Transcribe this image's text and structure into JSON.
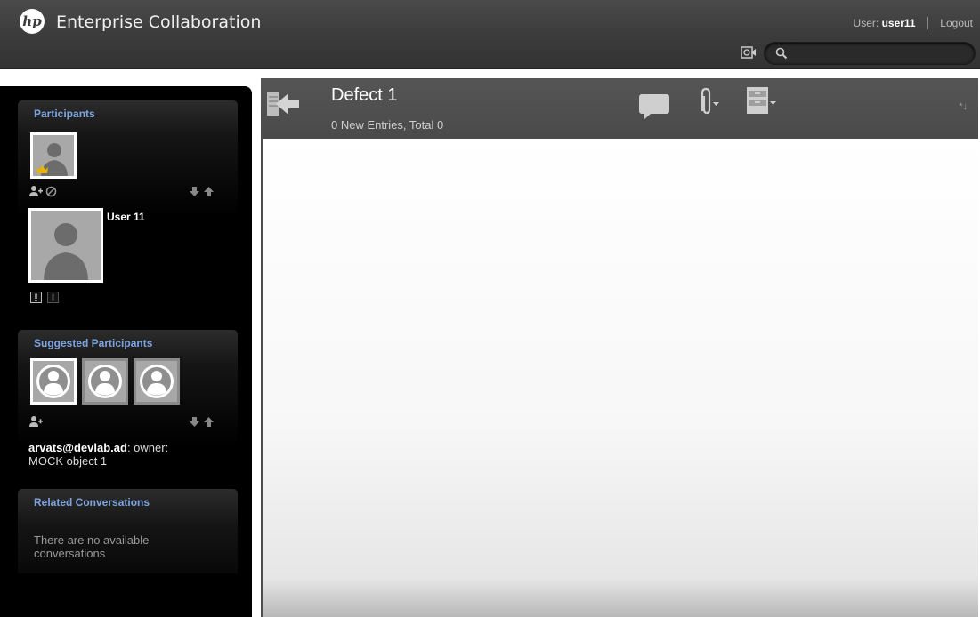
{
  "header": {
    "logo_text": "hp",
    "app_title": "Enterprise Collaboration",
    "user_label": "User:",
    "username": "user11",
    "logout_label": "Logout",
    "search_placeholder": ""
  },
  "participants": {
    "title": "Participants",
    "selected_user_name": "User 11"
  },
  "suggested": {
    "title": "Suggested Participants",
    "email": "arvats@devlab.ad",
    "detail_suffix": ": owner:",
    "object_name": "MOCK object 1"
  },
  "related": {
    "title": "Related Conversations",
    "empty_message": "There are no available conversations"
  },
  "conversation": {
    "title": "Defect 1",
    "subtitle": "0 New Entries, Total 0",
    "sort_indicator": "*↓"
  },
  "colors": {
    "panel_title": "#7ea4e0",
    "header_bg": "#3c3c3c",
    "main_header_bg": "#4d4d4d"
  },
  "icons": {
    "back": "back-arrow-icon",
    "comment": "comment-icon",
    "attach": "paperclip-icon",
    "archive": "file-cabinet-icon",
    "search": "search-icon",
    "screen": "screen-capture-icon"
  }
}
